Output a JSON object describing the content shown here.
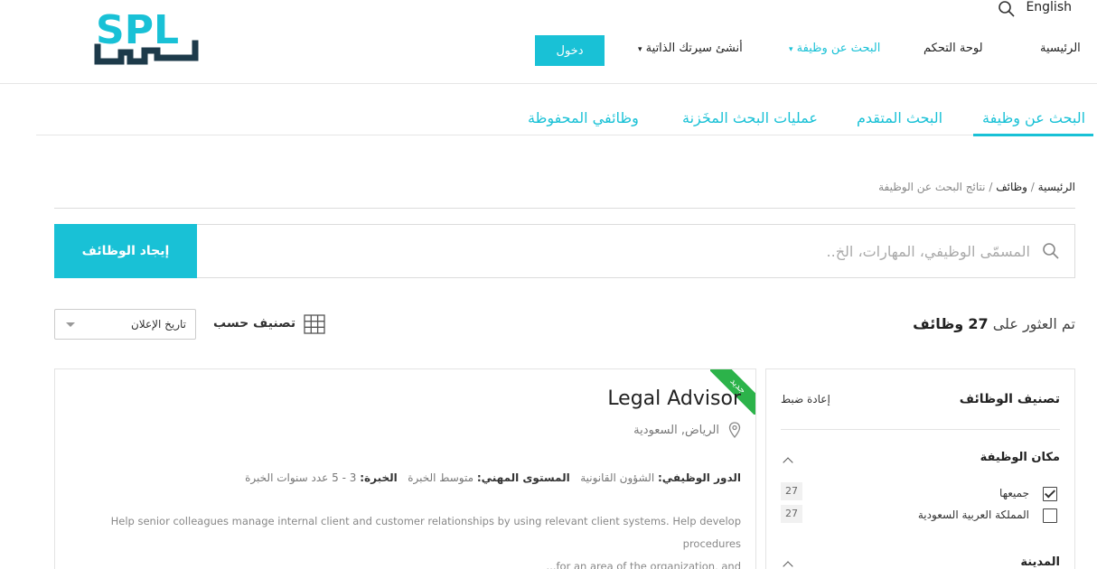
{
  "header": {
    "logo_text": "SPL",
    "language": "English",
    "nav": {
      "home": "الرئيسية",
      "dashboard": "لوحة التحكم",
      "job_search": "البحث عن وظيفة",
      "create_cv": "أنشئ سيرتك الذاتية",
      "login": "دخول"
    }
  },
  "tabs": {
    "job_search": "البحث عن وظيفة",
    "advanced": "البحث المتقدم",
    "saved_searches": "عمليات البحث المخَزنة",
    "saved_jobs": "وظائفي المحفوظة"
  },
  "breadcrumb": {
    "home": "الرئيسية",
    "jobs": "وظائف",
    "current": "نتائج البحث عن الوظيفة"
  },
  "search": {
    "placeholder": "المسمّى الوظيفي، المهارات، الخ..",
    "button": "إيجاد الوظائف"
  },
  "results": {
    "prefix": "تم العثور على",
    "count": "27",
    "suffix": "وظائف"
  },
  "sort": {
    "label": "تصنيف حسب",
    "selected": "تاريخ الإعلان"
  },
  "job": {
    "badge": "جديد",
    "title": "Legal Advisor",
    "location": "الرياض, السعودية",
    "role_label": "الدور الوظيفي:",
    "role_value": "الشؤون القانونية",
    "level_label": "المستوى المهني:",
    "level_value": "متوسط الخبرة",
    "experience_label": "الخبرة:",
    "experience_value": "3 - 5 عدد سنوات الخبرة",
    "description_line1": "Help senior colleagues manage internal client and customer relationships by using relevant client systems. Help develop procedures",
    "description_line2": "...for an area of the organization, and"
  },
  "sidebar": {
    "title": "تصنيف الوظائف",
    "reset": "إعادة ضبط",
    "location_title": "مكان الوظيفة",
    "options": [
      {
        "label": "جميعها",
        "count": "27",
        "checked": true
      },
      {
        "label": "المملكة العربية السعودية",
        "count": "27",
        "checked": false
      }
    ],
    "city_title": "المدينة"
  },
  "colors": {
    "accent": "#19c1d6",
    "badge": "#2cb34a",
    "logo_dark": "#1d3a4a"
  }
}
